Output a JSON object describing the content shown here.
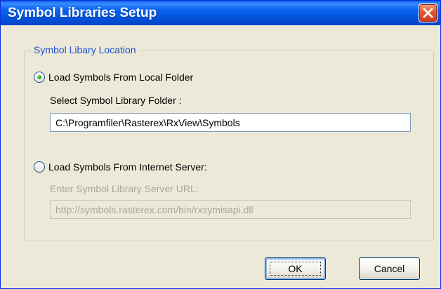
{
  "window": {
    "title": "Symbol Libraries Setup",
    "close_icon": "close-icon"
  },
  "group": {
    "title": "Symbol Libary Location"
  },
  "local_option": {
    "label": "Load Symbols From Local Folder",
    "selected": true,
    "field_label": "Select Symbol Library Folder :",
    "folder_value": "C:\\Programfiler\\Rasterex\\RxView\\Symbols"
  },
  "server_option": {
    "label": "Load Symbols From Internet Server:",
    "selected": false,
    "field_label": "Enter Symbol Library Server URL:",
    "url_value": "http://symbols.rasterex.com/bin/rxsymisapi.dll"
  },
  "buttons": {
    "ok_label": "OK",
    "cancel_label": "Cancel"
  },
  "colors": {
    "title_bar": "#0352d8",
    "dialog_background": "#ece9d8",
    "group_title": "#1f4fcf",
    "close_button": "#e75a32",
    "disabled_text": "#a8a79d"
  }
}
